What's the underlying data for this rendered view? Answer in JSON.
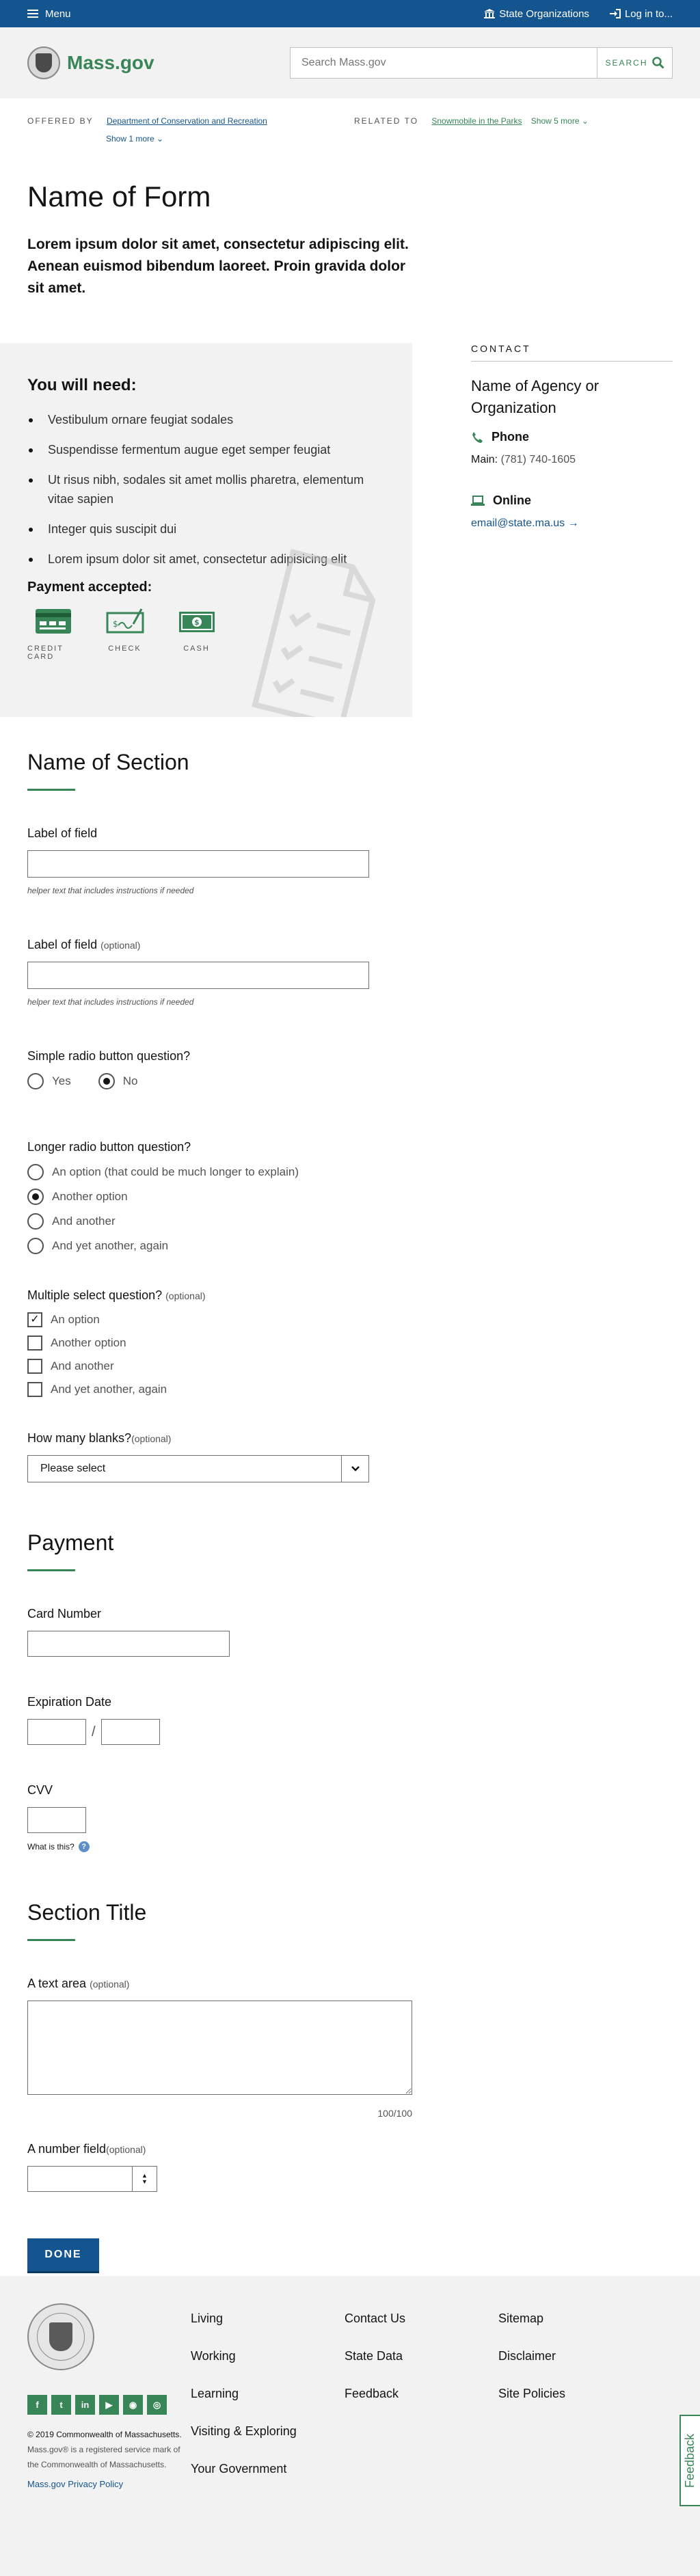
{
  "utility_bar": {
    "menu_label": "Menu",
    "state_orgs": "State Organizations",
    "login": "Log in to..."
  },
  "header": {
    "logo_text": "Mass.gov",
    "search_placeholder": "Search Mass.gov",
    "search_button": "SEARCH"
  },
  "offered": {
    "offered_label": "OFFERED BY",
    "offered_link": "Department of Conservation and Recreation",
    "show_more": "Show 1 more",
    "related_label": "RELATED TO",
    "related_link": "Snowmobile in the Parks",
    "related_more": "Show 5 more"
  },
  "page": {
    "title": "Name of Form",
    "lede": "Lorem ipsum dolor sit amet, consectetur adipiscing elit. Aenean euismod bibendum laoreet. Proin gravida dolor sit amet."
  },
  "need": {
    "heading": "You will need:",
    "items": [
      "Vestibulum ornare feugiat sodales",
      "Suspendisse fermentum augue eget semper feugiat",
      "Ut risus nibh, sodales sit amet mollis pharetra, elementum vitae sapien",
      "Integer quis suscipit dui",
      "Lorem ipsum dolor sit amet, consectetur adipisicing elit"
    ],
    "payment_heading": "Payment accepted:",
    "payment_methods": [
      "CREDIT CARD",
      "CHECK",
      "CASH"
    ]
  },
  "contact": {
    "heading": "CONTACT",
    "agency": "Name of Agency or Organization",
    "phone_label": "Phone",
    "main_label": "Main:",
    "main_number": "(781) 740-1605",
    "online_label": "Online",
    "email": "email@state.ma.us"
  },
  "form": {
    "section1_title": "Name of Section",
    "field1_label": "Label of field",
    "field1_helper": "helper text that includes instructions if needed",
    "field2_label": "Label of field",
    "field2_optional": "(optional)",
    "field2_helper": "helper text that includes instructions if needed",
    "simple_radio_label": "Simple radio button question?",
    "simple_radio_options": [
      "Yes",
      "No"
    ],
    "simple_radio_selected": "No",
    "long_radio_label": "Longer radio button question?",
    "long_radio_options": [
      "An option (that could be much longer to explain)",
      "Another option",
      "And another",
      "And yet another, again"
    ],
    "long_radio_selected": "Another option",
    "multi_label": "Multiple select question?",
    "multi_optional": "(optional)",
    "multi_options": [
      "An option",
      "Another option",
      "And another",
      "And yet another, again"
    ],
    "multi_checked": [
      "An option"
    ],
    "blanks_label": "How many blanks?",
    "blanks_optional": "(optional)",
    "blanks_value": "Please select",
    "payment_title": "Payment",
    "card_label": "Card Number",
    "exp_label": "Expiration Date",
    "cvv_label": "CVV",
    "what_is_this": "What is this?",
    "section3_title": "Section Title",
    "textarea_label": "A text area",
    "textarea_optional": "(optional)",
    "counter": "100/100",
    "number_label": "A number field",
    "number_optional": "(optional)",
    "done": "DONE"
  },
  "footer": {
    "links": [
      "Living",
      "Contact Us",
      "Sitemap",
      "Working",
      "State Data",
      "Disclaimer",
      "Learning",
      "Feedback",
      "Site Policies",
      "Visiting & Exploring",
      "",
      "",
      "Your Government"
    ],
    "social_icons": [
      "facebook-icon",
      "twitter-icon",
      "linkedin-icon",
      "youtube-icon",
      "rss-icon",
      "instagram-icon"
    ],
    "copyright": "© 2019 Commonwealth of Massachusetts.",
    "trademark": "Mass.gov® is a registered service mark of the Commonwealth of Massachusetts.",
    "privacy": "Mass.gov Privacy Policy"
  },
  "feedback_tab": "Feedback",
  "colors": {
    "blue": "#14558f",
    "green": "#388557",
    "gray_bg": "#f2f2f2"
  }
}
